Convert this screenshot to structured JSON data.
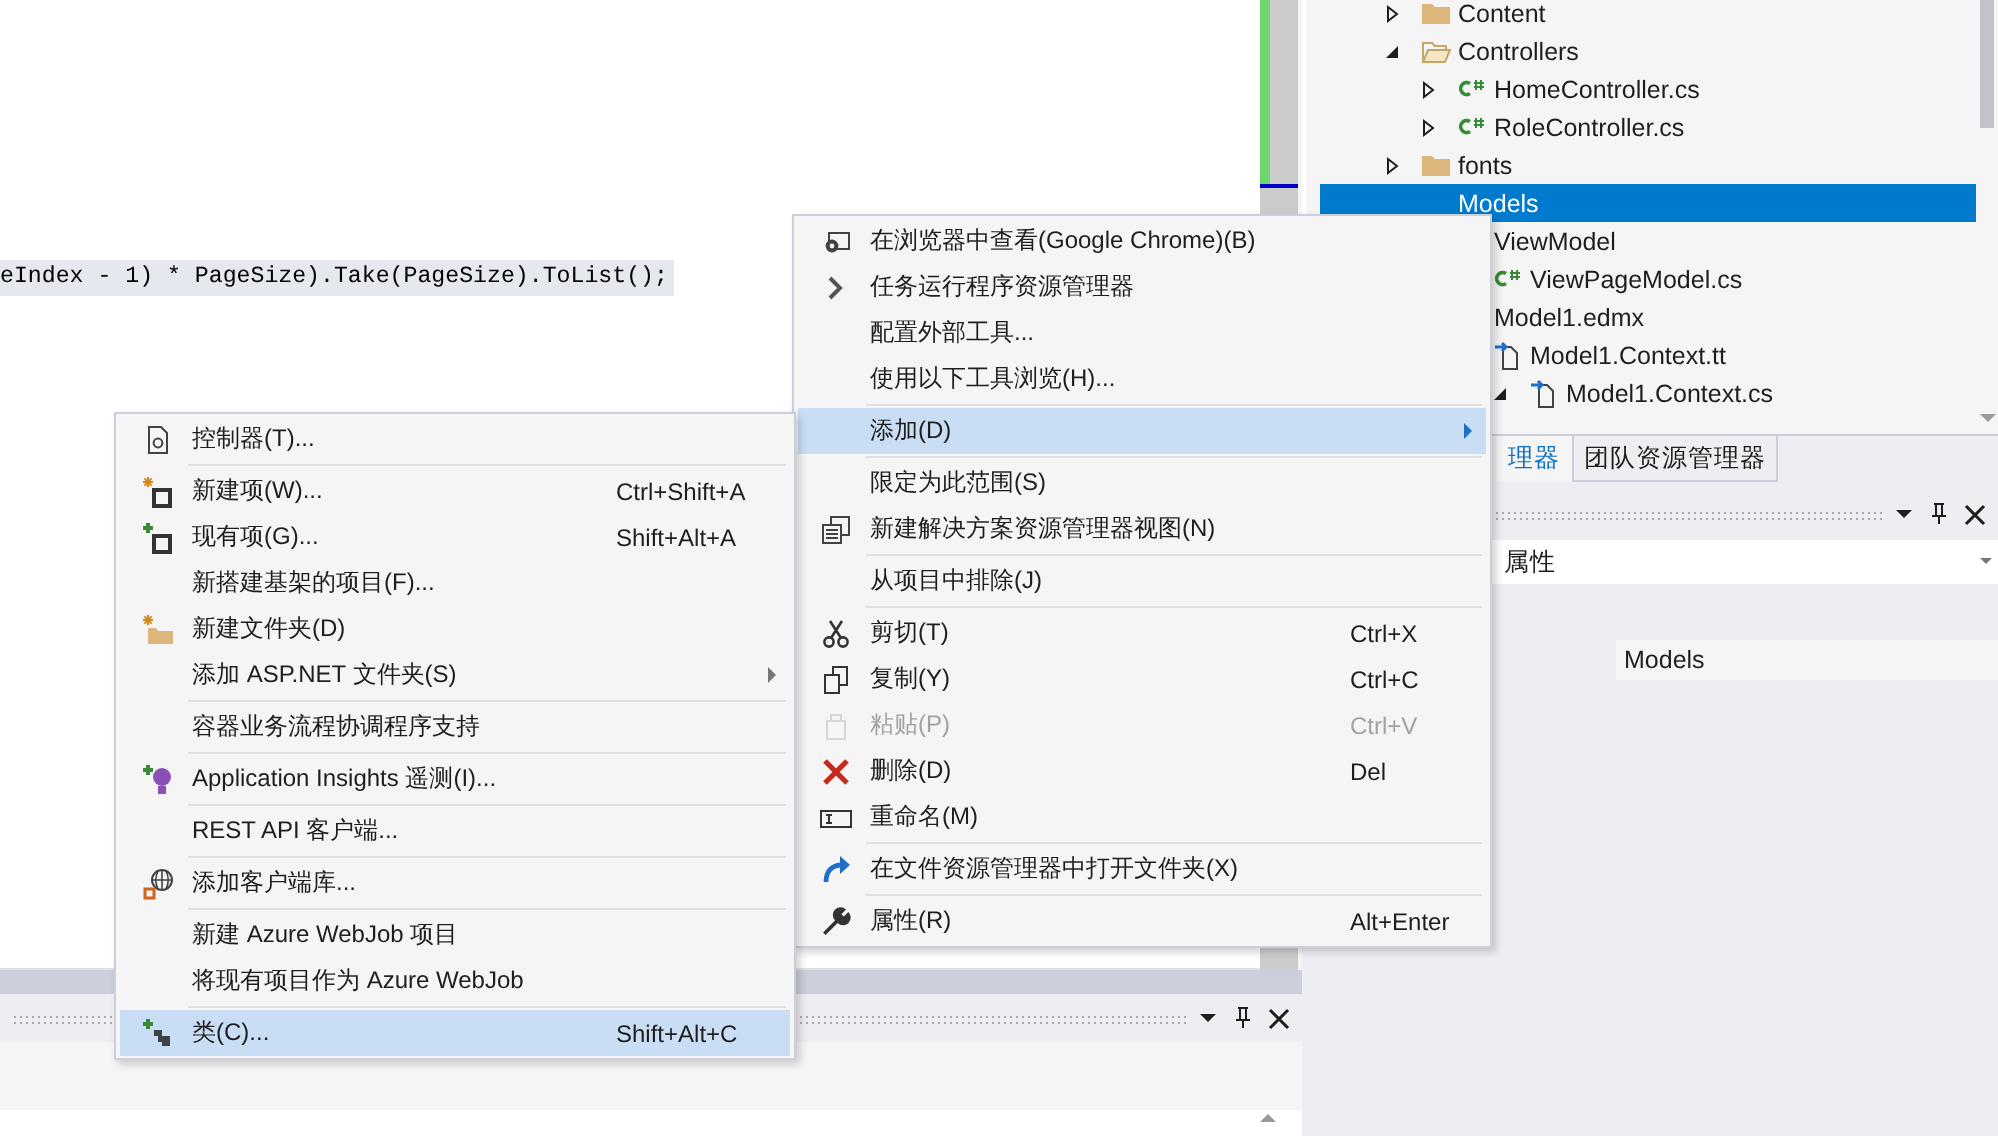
{
  "editor": {
    "code_line": "eIndex - 1) * PageSize).Take(PageSize).ToList();"
  },
  "solution_explorer": {
    "tree": [
      {
        "label": "Content",
        "kind": "folder",
        "expanded": false,
        "selected": false
      },
      {
        "label": "Controllers",
        "kind": "open_folder",
        "expanded": true,
        "selected": false,
        "children": [
          {
            "label": "HomeController.cs",
            "kind": "csharp",
            "expanded": false,
            "selected": false
          },
          {
            "label": "RoleController.cs",
            "kind": "csharp",
            "expanded": false,
            "selected": false
          }
        ]
      },
      {
        "label": "fonts",
        "kind": "folder",
        "expanded": false,
        "selected": false
      },
      {
        "label": "Models",
        "kind": "open_folder",
        "expanded": true,
        "selected": true,
        "children": [
          {
            "label": "ViewModel",
            "kind": "open_folder",
            "expanded": true,
            "selected": false,
            "children": [
              {
                "label": "ViewPageModel.cs",
                "kind": "csharp",
                "expanded": false,
                "selected": false
              }
            ]
          },
          {
            "label": "Model1.edmx",
            "kind": "model",
            "expanded": true,
            "selected": false,
            "children": [
              {
                "label": "Model1.Context.tt",
                "kind": "template",
                "expanded": true,
                "selected": false,
                "children": [
                  {
                    "label": "Model1.Context.cs",
                    "kind": "template",
                    "expanded": true,
                    "selected": false
                  }
                ]
              }
            ]
          }
        ]
      }
    ]
  },
  "tool_tabs": [
    {
      "label": "理器",
      "selected": true
    },
    {
      "label": "团队资源管理器",
      "selected": false
    }
  ],
  "properties": {
    "selector": "属性",
    "rows": [
      {
        "value": "Models"
      }
    ]
  },
  "context_menus": [
    {
      "items": [
        {
          "kind": "item",
          "label": "在浏览器中查看(Google Chrome)(B)",
          "selected": false,
          "disabled": false,
          "submenu": false
        },
        {
          "kind": "item",
          "label": "任务运行程序资源管理器",
          "selected": false,
          "disabled": false,
          "submenu": false
        },
        {
          "kind": "item",
          "label": "配置外部工具...",
          "selected": false,
          "disabled": false,
          "submenu": false
        },
        {
          "kind": "item",
          "label": "使用以下工具浏览(H)...",
          "selected": false,
          "disabled": false,
          "submenu": false
        },
        {
          "kind": "separator"
        },
        {
          "kind": "item",
          "label": "添加(D)",
          "selected": true,
          "disabled": false,
          "submenu": true
        },
        {
          "kind": "separator"
        },
        {
          "kind": "item",
          "label": "限定为此范围(S)",
          "selected": false,
          "disabled": false,
          "submenu": false
        },
        {
          "kind": "item",
          "label": "新建解决方案资源管理器视图(N)",
          "selected": false,
          "disabled": false,
          "submenu": false
        },
        {
          "kind": "separator"
        },
        {
          "kind": "item",
          "label": "从项目中排除(J)",
          "selected": false,
          "disabled": false,
          "submenu": false
        },
        {
          "kind": "separator"
        },
        {
          "kind": "item",
          "label": "剪切(T)",
          "shortcut": "Ctrl+X",
          "selected": false,
          "disabled": false,
          "submenu": false
        },
        {
          "kind": "item",
          "label": "复制(Y)",
          "shortcut": "Ctrl+C",
          "selected": false,
          "disabled": false,
          "submenu": false
        },
        {
          "kind": "item",
          "label": "粘贴(P)",
          "shortcut": "Ctrl+V",
          "selected": false,
          "disabled": true,
          "submenu": false
        },
        {
          "kind": "item",
          "label": "删除(D)",
          "shortcut": "Del",
          "selected": false,
          "disabled": false,
          "submenu": false
        },
        {
          "kind": "item",
          "label": "重命名(M)",
          "selected": false,
          "disabled": false,
          "submenu": false
        },
        {
          "kind": "separator"
        },
        {
          "kind": "item",
          "label": "在文件资源管理器中打开文件夹(X)",
          "selected": false,
          "disabled": false,
          "submenu": false
        },
        {
          "kind": "separator"
        },
        {
          "kind": "item",
          "label": "属性(R)",
          "shortcut": "Alt+Enter",
          "selected": false,
          "disabled": false,
          "submenu": false
        }
      ]
    },
    {
      "items": [
        {
          "kind": "item",
          "label": "控制器(T)...",
          "selected": false,
          "disabled": false,
          "submenu": false
        },
        {
          "kind": "separator"
        },
        {
          "kind": "item",
          "label": "新建项(W)...",
          "shortcut": "Ctrl+Shift+A",
          "selected": false,
          "disabled": false,
          "submenu": false
        },
        {
          "kind": "item",
          "label": "现有项(G)...",
          "shortcut": "Shift+Alt+A",
          "selected": false,
          "disabled": false,
          "submenu": false
        },
        {
          "kind": "item",
          "label": "新搭建基架的项目(F)...",
          "selected": false,
          "disabled": false,
          "submenu": false
        },
        {
          "kind": "item",
          "label": "新建文件夹(D)",
          "selected": false,
          "disabled": false,
          "submenu": false
        },
        {
          "kind": "item",
          "label": "添加 ASP.NET 文件夹(S)",
          "selected": false,
          "disabled": false,
          "submenu": true
        },
        {
          "kind": "separator"
        },
        {
          "kind": "item",
          "label": "容器业务流程协调程序支持",
          "selected": false,
          "disabled": false,
          "submenu": false
        },
        {
          "kind": "separator"
        },
        {
          "kind": "item",
          "label": "Application Insights 遥测(I)...",
          "selected": false,
          "disabled": false,
          "submenu": false
        },
        {
          "kind": "separator"
        },
        {
          "kind": "item",
          "label": "REST API 客户端...",
          "selected": false,
          "disabled": false,
          "submenu": false
        },
        {
          "kind": "separator"
        },
        {
          "kind": "item",
          "label": "添加客户端库...",
          "selected": false,
          "disabled": false,
          "submenu": false
        },
        {
          "kind": "separator"
        },
        {
          "kind": "item",
          "label": "新建 Azure WebJob 项目",
          "selected": false,
          "disabled": false,
          "submenu": false
        },
        {
          "kind": "item",
          "label": "将现有项目作为 Azure WebJob",
          "selected": false,
          "disabled": false,
          "submenu": false
        },
        {
          "kind": "separator"
        },
        {
          "kind": "item",
          "label": "类(C)...",
          "shortcut": "Shift+Alt+C",
          "selected": true,
          "disabled": false,
          "submenu": false
        }
      ]
    }
  ]
}
